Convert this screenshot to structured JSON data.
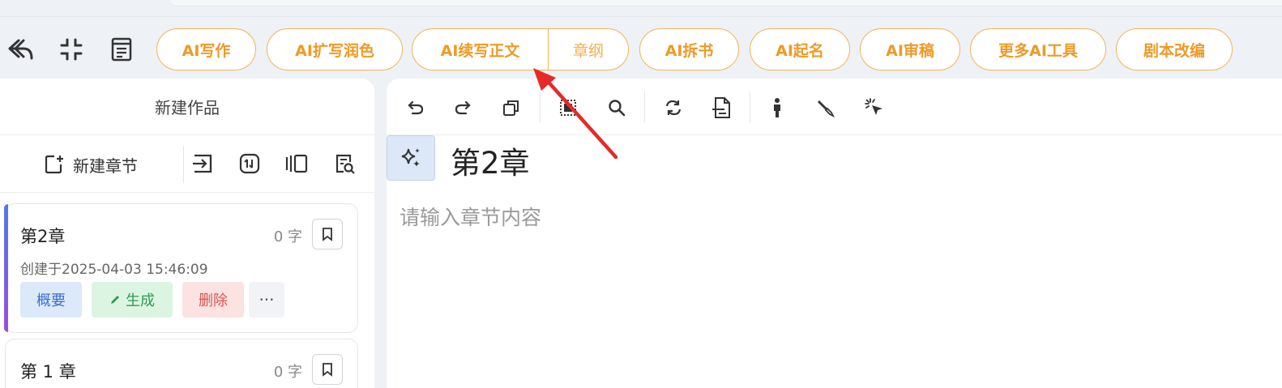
{
  "toolbar": {
    "buttons": [
      {
        "label": "AI写作"
      },
      {
        "label": "AI扩写润色"
      },
      {
        "label": "AI续写正文",
        "secondary": "章纲"
      },
      {
        "label": "AI拆书"
      },
      {
        "label": "AI起名"
      },
      {
        "label": "AI审稿"
      },
      {
        "label": "更多AI工具"
      },
      {
        "label": "剧本改编"
      }
    ],
    "icons": [
      "back-icon",
      "collapse-icon",
      "document-icon"
    ]
  },
  "sidebar": {
    "title": "新建作品",
    "new_chapter_label": "新建章节",
    "tool_icons": [
      "import-icon",
      "sort-icon",
      "layout-icon",
      "search-doc-icon"
    ],
    "chapters": [
      {
        "name": "第2章",
        "word_count": "0 字",
        "created": "创建于2025-04-03 15:46:09",
        "actions": {
          "summary": "概要",
          "generate": "生成",
          "delete": "删除",
          "more": "···"
        }
      },
      {
        "name": "第 1 章",
        "word_count": "0 字"
      }
    ]
  },
  "editor": {
    "chapter_title": "第2章",
    "placeholder": "请输入章节内容",
    "tool_icons": [
      "undo-icon",
      "redo-icon",
      "copy-icon",
      "select-all-icon",
      "search-icon",
      "replace-icon",
      "format-icon",
      "person-icon",
      "highlighter-icon",
      "cursor-click-icon"
    ]
  },
  "colors": {
    "accent_orange": "#ee9a25",
    "annotation_arrow": "#e52a2a"
  }
}
